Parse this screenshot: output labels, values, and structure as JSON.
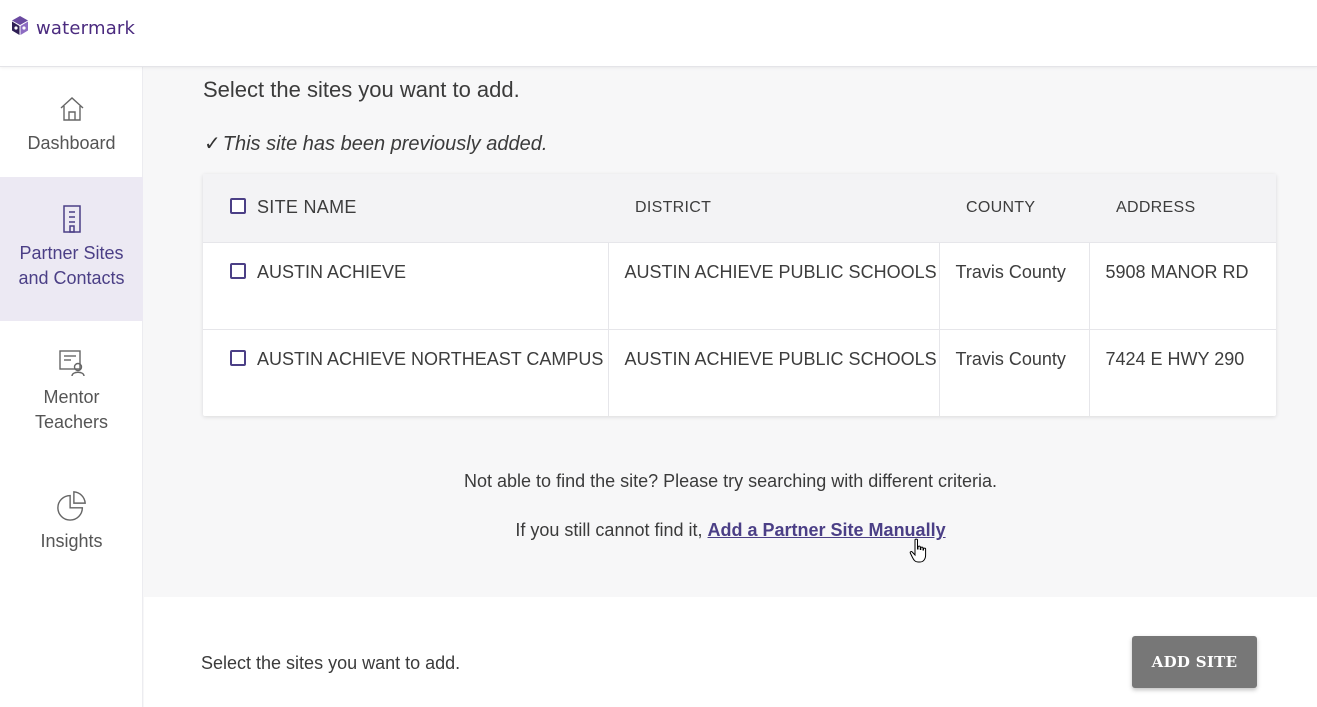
{
  "app": {
    "logo_text": "watermark",
    "accent": "#4b3f86"
  },
  "sidebar": {
    "items": [
      {
        "label": "Dashboard",
        "icon": "home-icon"
      },
      {
        "label": "Partner Sites and Contacts",
        "icon": "building-icon",
        "active": true
      },
      {
        "label": "Mentor Teachers",
        "icon": "mentor-certificate-icon"
      },
      {
        "label": "Insights",
        "icon": "pie-chart-icon"
      }
    ]
  },
  "main": {
    "heading": "Select the sites you want to add.",
    "previously_added_note": "This site has been previously added.",
    "table": {
      "headers": [
        "SITE NAME",
        "DISTRICT",
        "COUNTY",
        "ADDRESS"
      ],
      "rows": [
        {
          "site_name": "AUSTIN ACHIEVE",
          "district": "AUSTIN ACHIEVE PUBLIC SCHOOLS",
          "county": "Travis County",
          "address": "5908 MANOR RD"
        },
        {
          "site_name": "AUSTIN ACHIEVE NORTHEAST CAMPUS",
          "district": "AUSTIN ACHIEVE PUBLIC SCHOOLS",
          "county": "Travis County",
          "address": "7424 E HWY 290"
        }
      ]
    },
    "not_found_text": "Not able to find the site? Please try searching with different criteria.",
    "still_prefix": "If you still cannot find it,",
    "manual_link": "Add a Partner Site Manually"
  },
  "footer": {
    "text": "Select the sites you want to add.",
    "add_button": "ADD SITE"
  }
}
